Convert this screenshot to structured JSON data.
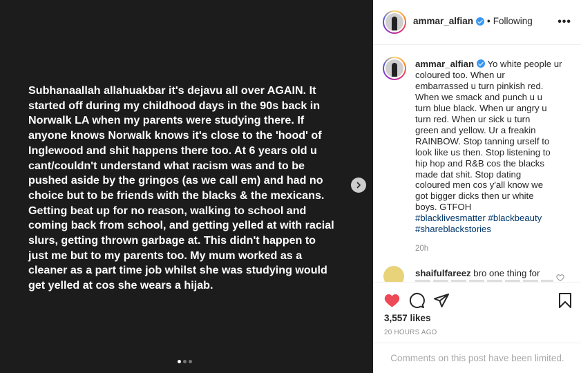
{
  "media": {
    "text": "Subhanaallah allahuakbar it's dejavu all over AGAIN.  It\nstarted off during my childhood days in the 90s back in\nNorwalk LA when my parents were studying there. If\nanyone knows Norwalk knows it's close to the 'hood' of\nInglewood and shit happens there too. At 6 years old u\ncant/couldn't understand what racism was and to be\npushed aside by the gringos (as we call em) and had no\nchoice but to be friends with the blacks & the mexicans.\nGetting beat up for no reason, walking to school and\ncoming back from school, and getting yelled at with racial\nslurs, getting thrown garbage at. This didn't happen to\njust me but to my parents too. My mum worked as a\ncleaner as a part time job whilst she was studying would\nget yelled at cos she wears a hijab.",
    "carousel": {
      "current": 1,
      "total": 3
    }
  },
  "header": {
    "username": "ammar_alfian",
    "separator": "•",
    "follow_status": "Following",
    "more": "•••"
  },
  "caption": {
    "username": "ammar_alfian",
    "text": "Yo white people ur\ncoloured too. When ur\nembarrassed u turn pinkish red.\nWhen we smack and punch u u\nturn blue black. When ur angry u\nturn red. When ur sick u turn\ngreen and yellow. Ur a freakin\nRAINBOW. Stop tanning urself to\nlook like us then. Stop listening to\nhip hop and R&B cos the blacks\nmade dat shit. Stop dating\ncoloured men cos y'all know we\ngot bigger dicks then ur white\nboys. GTFOH",
    "hashtags": "#blacklivesmatter #blackbeauty\n#shareblackstories",
    "time": "20h"
  },
  "comment": {
    "username": "shaifulfareez",
    "text": "bro one thing for"
  },
  "actions": {
    "likes": "3,557 likes",
    "timestamp": "20 HOURS AGO",
    "comments_limited": "Comments on this post have been limited."
  },
  "colors": {
    "like_red": "#ed4956",
    "verified_blue": "#3897f0",
    "hashtag_blue": "#00376b"
  }
}
